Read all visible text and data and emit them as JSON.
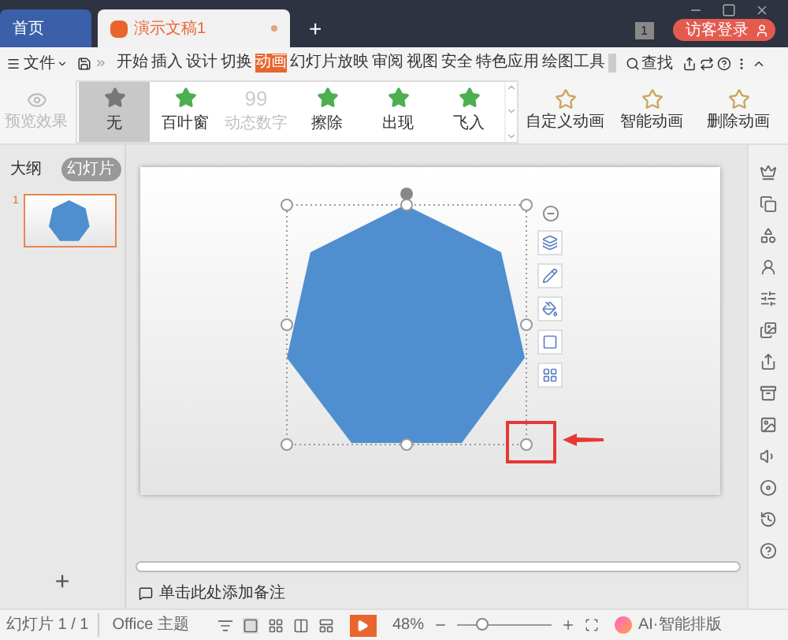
{
  "title_bar": {
    "tabs": [
      {
        "label": "首页",
        "selected": false,
        "kind": "home"
      },
      {
        "label": "演示文稿1",
        "selected": true,
        "kind": "doc"
      }
    ],
    "new_tab": "+",
    "badge": "1",
    "login": "访客登录"
  },
  "menu_bar": {
    "file": "文件",
    "tabs": [
      {
        "label": "开始",
        "selected": false
      },
      {
        "label": "插入",
        "selected": false
      },
      {
        "label": "设计",
        "selected": false
      },
      {
        "label": "切换",
        "selected": false
      },
      {
        "label": "动画",
        "selected": true
      },
      {
        "label": "幻灯片放映",
        "selected": false
      },
      {
        "label": "审阅",
        "selected": false
      },
      {
        "label": "视图",
        "selected": false
      },
      {
        "label": "安全",
        "selected": false
      },
      {
        "label": "特色应用",
        "selected": false
      },
      {
        "label": "绘图工具",
        "selected": false
      }
    ],
    "search": "查找"
  },
  "ribbon": {
    "preview": {
      "label": "预览效果",
      "disabled": true
    },
    "effects": [
      {
        "label": "无",
        "kind": "star",
        "selected": true,
        "disabled": false
      },
      {
        "label": "百叶窗",
        "kind": "star",
        "selected": false,
        "disabled": false
      },
      {
        "label": "动态数字",
        "kind": "digits",
        "glyph": "99",
        "selected": false,
        "disabled": true
      },
      {
        "label": "擦除",
        "kind": "star",
        "selected": false,
        "disabled": false
      },
      {
        "label": "出现",
        "kind": "star",
        "selected": false,
        "disabled": false
      },
      {
        "label": "飞入",
        "kind": "star",
        "selected": false,
        "disabled": false
      }
    ],
    "actions": [
      "自定义动画",
      "智能动画",
      "删除动画"
    ]
  },
  "panel": {
    "tabs": [
      {
        "label": "大纲",
        "selected": false
      },
      {
        "label": "幻灯片",
        "selected": true
      }
    ],
    "slides": [
      {
        "number": "1",
        "selected": true
      }
    ],
    "add": "+"
  },
  "notes": {
    "placeholder": "单击此处添加备注"
  },
  "status_bar": {
    "slide": "幻灯片 1 / 1",
    "theme": "Office 主题",
    "zoom": "48%",
    "zoom_slider": {
      "level": 0.27
    },
    "ai": "AI·智能排版"
  }
}
